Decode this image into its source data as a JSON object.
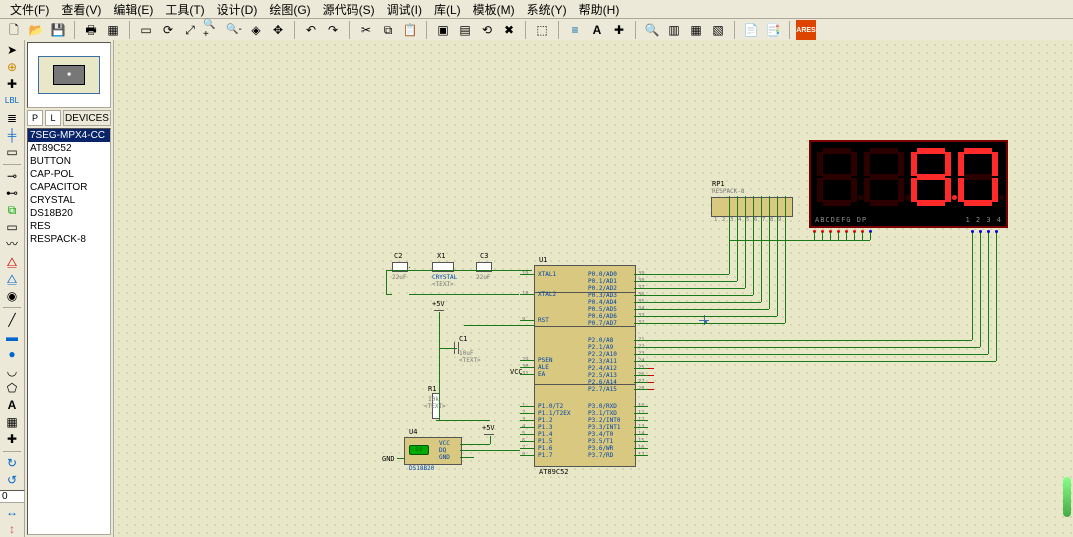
{
  "menu": {
    "file": "文件(F)",
    "view": "查看(V)",
    "edit": "编辑(E)",
    "tools": "工具(T)",
    "design": "设计(D)",
    "graph": "绘图(G)",
    "source": "源代码(S)",
    "debug": "调试(I)",
    "lib": "库(L)",
    "template": "模板(M)",
    "system": "系统(Y)",
    "help": "帮助(H)"
  },
  "devices": {
    "header_label": "DEVICES",
    "items": [
      "7SEG-MPX4-CC",
      "AT89C52",
      "BUTTON",
      "CAP-POL",
      "CAPACITOR",
      "CRYSTAL",
      "DS18B20",
      "RES",
      "RESPACK-8"
    ],
    "selected_index": 0,
    "p_label": "P",
    "l_label": "L"
  },
  "coord_box": "0",
  "schematic": {
    "mcu": {
      "ref": "U1",
      "part": "AT89C52",
      "left_pins": [
        {
          "num": "19",
          "name": "XTAL1"
        },
        {
          "num": "18",
          "name": "XTAL2"
        },
        {
          "num": "9",
          "name": "RST"
        },
        {
          "num": "29",
          "name": "PSEN"
        },
        {
          "num": "30",
          "name": "ALE"
        },
        {
          "num": "31",
          "name": "EA"
        },
        {
          "num": "1",
          "name": "P1.0/T2"
        },
        {
          "num": "2",
          "name": "P1.1/T2EX"
        },
        {
          "num": "3",
          "name": "P1.2"
        },
        {
          "num": "4",
          "name": "P1.3"
        },
        {
          "num": "5",
          "name": "P1.4"
        },
        {
          "num": "6",
          "name": "P1.5"
        },
        {
          "num": "7",
          "name": "P1.6"
        },
        {
          "num": "8",
          "name": "P1.7"
        }
      ],
      "right_top": [
        {
          "num": "39",
          "name": "P0.0/AD0"
        },
        {
          "num": "38",
          "name": "P0.1/AD1"
        },
        {
          "num": "37",
          "name": "P0.2/AD2"
        },
        {
          "num": "36",
          "name": "P0.3/AD3"
        },
        {
          "num": "35",
          "name": "P0.4/AD4"
        },
        {
          "num": "34",
          "name": "P0.5/AD5"
        },
        {
          "num": "33",
          "name": "P0.6/AD6"
        },
        {
          "num": "32",
          "name": "P0.7/AD7"
        }
      ],
      "right_mid": [
        {
          "num": "21",
          "name": "P2.0/A8"
        },
        {
          "num": "22",
          "name": "P2.1/A9"
        },
        {
          "num": "23",
          "name": "P2.2/A10"
        },
        {
          "num": "24",
          "name": "P2.3/A11"
        },
        {
          "num": "25",
          "name": "P2.4/A12"
        },
        {
          "num": "26",
          "name": "P2.5/A13"
        },
        {
          "num": "27",
          "name": "P2.6/A14"
        },
        {
          "num": "28",
          "name": "P2.7/A15"
        }
      ],
      "right_bot": [
        {
          "num": "10",
          "name": "P3.0/RXD"
        },
        {
          "num": "11",
          "name": "P3.1/TXD"
        },
        {
          "num": "12",
          "name": "P3.2/INT0"
        },
        {
          "num": "13",
          "name": "P3.3/INT1"
        },
        {
          "num": "14",
          "name": "P3.4/T0"
        },
        {
          "num": "15",
          "name": "P3.5/T1"
        },
        {
          "num": "16",
          "name": "P3.6/WR"
        },
        {
          "num": "17",
          "name": "P3.7/RD"
        }
      ]
    },
    "respack": {
      "ref": "RP1",
      "part": "RESPACK-8"
    },
    "display": {
      "seg_labels": "ABCDEFG  DP",
      "com_labels": "1 2 3 4",
      "digits": [
        {
          "segments": ""
        },
        {
          "segments": ""
        },
        {
          "segments": "abcdefg",
          "dp": true
        },
        {
          "segments": "abcdef"
        }
      ]
    },
    "crystal": {
      "ref": "X1",
      "part": "CRYSTAL",
      "text": "<TEXT>"
    },
    "c2": {
      "ref": "C2",
      "val": "22uF"
    },
    "c3": {
      "ref": "C3",
      "val": "22uF"
    },
    "c1": {
      "ref": "C1",
      "val": "10uF",
      "text": "<TEXT>"
    },
    "r1": {
      "ref": "R1",
      "val": "10k",
      "text": "<TEXT>"
    },
    "vcc": "VCC",
    "gnd": "GND",
    "plus5v_1": "+5V",
    "plus5v_2": "+5V",
    "gnd_txt": "GND",
    "u4": {
      "ref": "U4",
      "part": "DS18B20",
      "vcc": "VCC",
      "dq": "DQ",
      "gnd": "GND",
      "disp": "0.0"
    }
  }
}
